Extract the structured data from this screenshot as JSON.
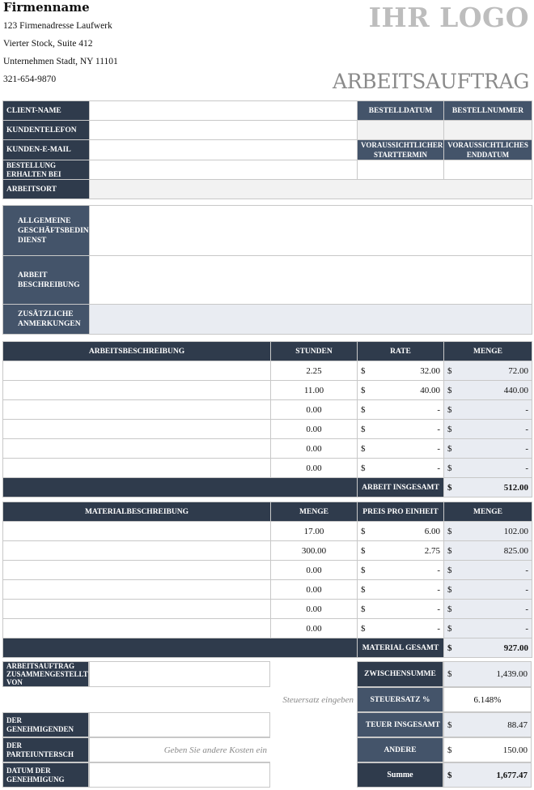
{
  "company": {
    "name": "Firmenname",
    "address1": "123 Firmenadresse Laufwerk",
    "address2": "Vierter Stock, Suite 412",
    "address3": "Unternehmen Stadt, NY 11101",
    "phone": "321-654-9870"
  },
  "logo_text": "IHR LOGO",
  "document_title": "ARBEITSAUFTRAG",
  "info": {
    "client_name": "CLIENT-NAME",
    "client_phone": "KUNDENTELEFON",
    "client_email": "KUNDEN-E-MAIL",
    "order_received_by": "BESTELLUNG ERHALTEN BEI",
    "work_location": "ARBEITSORT",
    "order_date": "BESTELLDATUM",
    "order_number": "BESTELLNUMMER",
    "expected_start": "VORAUSSICHTLICHER STARTTERMIN",
    "expected_end": "VORAUSSICHTLICHES ENDDATUM"
  },
  "description": {
    "terms_label": "ALLGEMEINE GESCHÄFTSBEDINGUNGEN DIENST",
    "work_desc_label": "ARBEIT BESCHREIBUNG",
    "notes_label": "ZUSÄTZLICHE ANMERKUNGEN"
  },
  "labor": {
    "headers": [
      "ARBEITSBESCHREIBUNG",
      "STUNDEN",
      "RATE",
      "MENGE"
    ],
    "rows": [
      {
        "desc": "",
        "hours": "2.25",
        "rate": "32.00",
        "amount": "72.00"
      },
      {
        "desc": "",
        "hours": "11.00",
        "rate": "40.00",
        "amount": "440.00"
      },
      {
        "desc": "",
        "hours": "0.00",
        "rate": "-",
        "amount": "-"
      },
      {
        "desc": "",
        "hours": "0.00",
        "rate": "-",
        "amount": "-"
      },
      {
        "desc": "",
        "hours": "0.00",
        "rate": "-",
        "amount": "-"
      },
      {
        "desc": "",
        "hours": "0.00",
        "rate": "-",
        "amount": "-"
      }
    ],
    "total_label": "ARBEIT INSGESAMT",
    "total": "512.00"
  },
  "material": {
    "headers": [
      "MATERIALBESCHREIBUNG",
      "MENGE",
      "PREIS PRO EINHEIT",
      "MENGE"
    ],
    "rows": [
      {
        "desc": "",
        "qty": "17.00",
        "price": "6.00",
        "amount": "102.00"
      },
      {
        "desc": "",
        "qty": "300.00",
        "price": "2.75",
        "amount": "825.00"
      },
      {
        "desc": "",
        "qty": "0.00",
        "price": "-",
        "amount": "-"
      },
      {
        "desc": "",
        "qty": "0.00",
        "price": "-",
        "amount": "-"
      },
      {
        "desc": "",
        "qty": "0.00",
        "price": "-",
        "amount": "-"
      },
      {
        "desc": "",
        "qty": "0.00",
        "price": "-",
        "amount": "-"
      }
    ],
    "total_label": "MATERIAL GESAMT",
    "total": "927.00"
  },
  "currency": "$",
  "signoff": {
    "compiled_by": "ARBEITSAUFTRAG ZUSAMMENGESTELLT VON",
    "approver": "DER GENEHMIGENDEN",
    "party_sign": "DER PARTEIUNTERSCH",
    "approval_date": "DATUM DER GENEHMIGUNG"
  },
  "summary": {
    "subtotal_label": "ZWISCHENSUMME",
    "subtotal": "1,439.00",
    "tax_hint": "Steuersatz eingeben",
    "tax_rate_label": "STEUERSATZ %",
    "tax_rate": "6.148%",
    "tax_total_label": "TEUER INSGESAMT",
    "tax_total": "88.47",
    "other_hint": "Geben Sie andere Kosten ein",
    "other_label": "ANDERE",
    "other": "150.00",
    "sum_label": "Summe",
    "sum": "1,677.47"
  }
}
